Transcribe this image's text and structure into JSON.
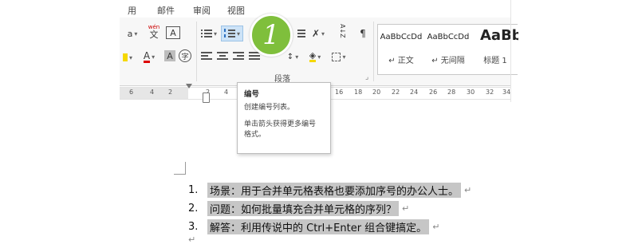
{
  "tabs": [
    "用",
    "邮件",
    "审阅",
    "视图"
  ],
  "ribbon": {
    "font_buttons": {
      "phonetic": "wén",
      "phonetic_char": "文",
      "char_border": "A",
      "font_color": "A",
      "char_shading": "A",
      "enclose": "字"
    },
    "sort_glyph": "A↓Z",
    "paragraph_group_label": "段落",
    "styles": [
      {
        "sample": "AaBbCcDd",
        "name": "↵ 正文"
      },
      {
        "sample": "AaBbCcDd",
        "name": "↵ 无间隔"
      },
      {
        "sample": "AaBb",
        "name": "标题 1"
      }
    ]
  },
  "ruler": {
    "left_numbers": [
      "6",
      "4",
      "2"
    ],
    "right_numbers": [
      "2",
      "4",
      "16",
      "18",
      "20",
      "22",
      "24",
      "26",
      "28",
      "30",
      "32",
      "34"
    ]
  },
  "badge": {
    "number": "1",
    "color": "#7fbf3c"
  },
  "tooltip": {
    "title": "编号",
    "line1": "创建编号列表。",
    "line2": "单击箭头获得更多编号",
    "line3": "格式。"
  },
  "document": {
    "items": [
      {
        "num": "1.",
        "text": "场景：用于合并单元格表格也要添加序号的办公人士。"
      },
      {
        "num": "2.",
        "text": "问题：如何批量填充合并单元格的序列？"
      },
      {
        "num": "3.",
        "text": "解答：利用传说中的 Ctrl+Enter 组合键搞定。"
      }
    ],
    "para_mark": "↵"
  }
}
